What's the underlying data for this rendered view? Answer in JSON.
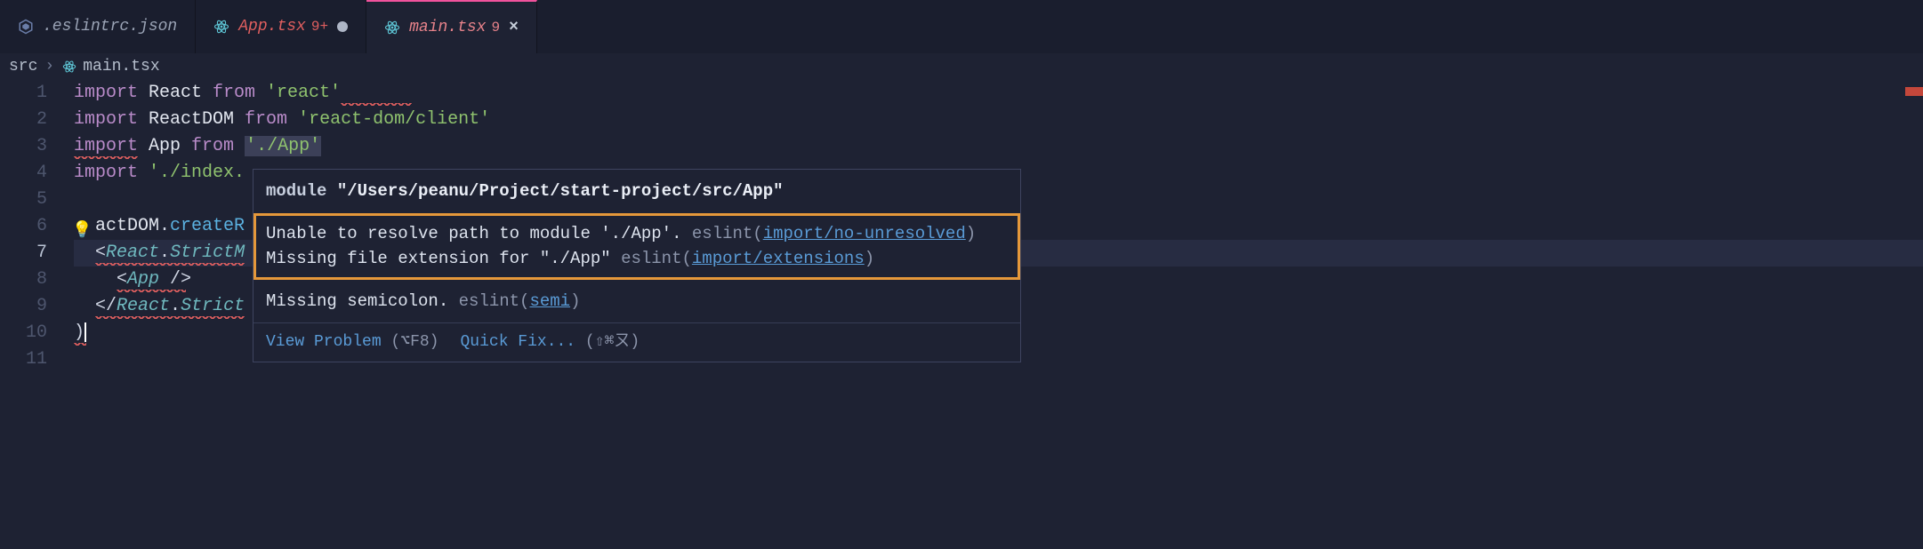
{
  "tabs": [
    {
      "label": ".eslintrc.json",
      "icon": "eslint"
    },
    {
      "label": "App.tsx",
      "icon": "react",
      "count": "9+",
      "dirty": true
    },
    {
      "label": "main.tsx",
      "icon": "react",
      "count": "9",
      "close": true,
      "active": true
    }
  ],
  "breadcrumb": {
    "segment1": "src",
    "segment2": "main.tsx"
  },
  "code": {
    "line1": {
      "kw": "import",
      "ident": " React ",
      "kw2": "from",
      "str": " 'react'",
      "sq_from": 300,
      "sq_to": 380
    },
    "line2": {
      "kw": "import",
      "ident": " ReactDOM ",
      "kw2": "from",
      "str": " 'react-dom/client'"
    },
    "line3": {
      "kw": "import",
      "ident": " App ",
      "kw2": "from",
      "str_hl": "'./App'",
      "sq_from": 0,
      "sq_to": 72
    },
    "line4": {
      "kw": "import",
      "str": " './index."
    },
    "line5": "",
    "line6": {
      "pre": "  ",
      "ident": "actDOM",
      "dot": ".",
      "func": "createR"
    },
    "line7": {
      "pre": "  ",
      "lt": "<",
      "comp": "React",
      "dot": ".",
      "comp2": "StrictM",
      "sq_from": 24,
      "sq_to": 192
    },
    "line8": {
      "pre": "    ",
      "lt": "<",
      "comp": "App",
      "close": " />",
      "sq_from": 48,
      "sq_to": 126
    },
    "line9": {
      "pre": "  ",
      "lt": "</",
      "comp": "React",
      "dot": ".",
      "comp2": "Strict",
      "sq_from": 24,
      "sq_to": 192
    },
    "line10": {
      "paren": ")"
    },
    "line11": ""
  },
  "line_numbers": [
    "1",
    "2",
    "3",
    "4",
    "5",
    "6",
    "7",
    "8",
    "9",
    "10",
    "11"
  ],
  "current_line_index": 6,
  "hover": {
    "module_kw": "module",
    "module_path": " \"/Users/peanu/Project/start-project/src/App\"",
    "msg1_a": "Unable to resolve path to module './App'.",
    "msg1_b": " eslint(",
    "msg1_link": "import/no-unresolved",
    "msg1_c": ")",
    "msg2_a": "Missing file extension for \"./App\"",
    "msg2_b": " eslint(",
    "msg2_link": "import/extensions",
    "msg2_c": ")",
    "msg3_a": "Missing semicolon.",
    "msg3_b": " eslint(",
    "msg3_link": "semi",
    "msg3_c": ")",
    "view_problem": "View Problem",
    "view_sc": " (⌥F8)",
    "quick_fix": "Quick Fix...",
    "quick_sc": " (⇧⌘ㄡ)"
  }
}
